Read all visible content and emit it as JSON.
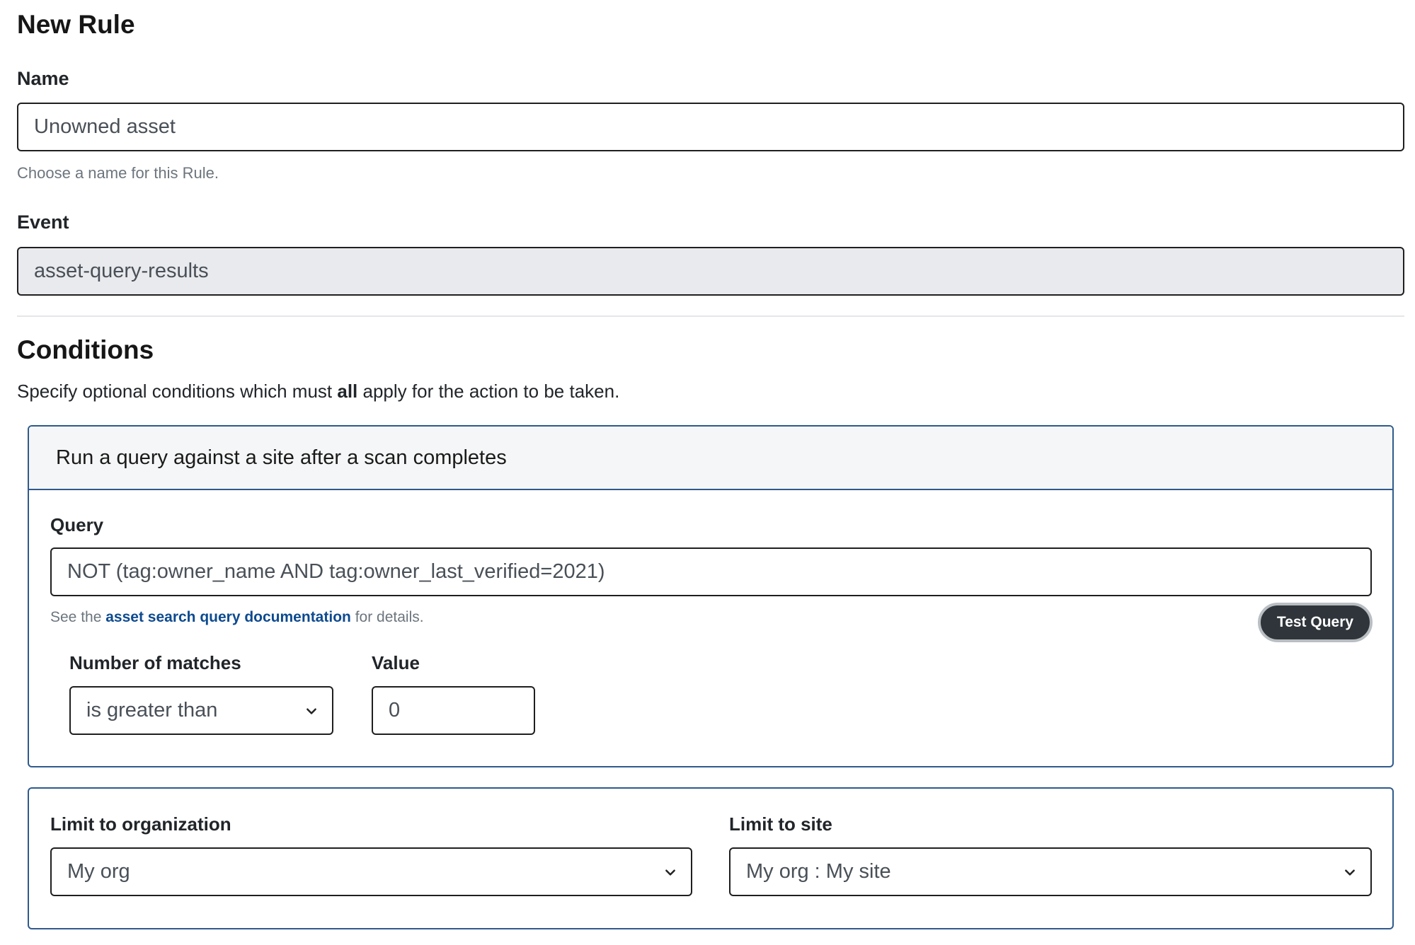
{
  "page_title": "New Rule",
  "name": {
    "label": "Name",
    "value": "Unowned asset",
    "hint": "Choose a name for this Rule."
  },
  "event": {
    "label": "Event",
    "value": "asset-query-results"
  },
  "conditions": {
    "title": "Conditions",
    "description_prefix": "Specify optional conditions which must ",
    "description_bold": "all",
    "description_suffix": " apply for the action to be taken.",
    "query_card": {
      "header": "Run a query against a site after a scan completes",
      "query_label": "Query",
      "query_value": "NOT (tag:owner_name AND tag:owner_last_verified=2021)",
      "hint_prefix": "See the ",
      "hint_link": "asset search query documentation",
      "hint_suffix": " for details.",
      "test_button": "Test Query",
      "matches_label": "Number of matches",
      "matches_value": "is greater than",
      "value_label": "Value",
      "value_value": "0"
    },
    "limit_card": {
      "org_label": "Limit to organization",
      "org_value": "My org",
      "site_label": "Limit to site",
      "site_value": "My org : My site"
    }
  },
  "icons": {
    "select_arrow": "chevron-down-icon"
  }
}
